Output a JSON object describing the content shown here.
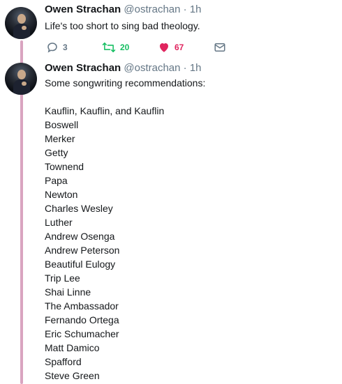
{
  "tweets": [
    {
      "author_name": "Owen Strachan",
      "handle": "@ostrachan",
      "separator": "·",
      "time": "1h",
      "text": "Life's too short to sing bad theology.",
      "actions": {
        "replies": "3",
        "retweets": "20",
        "likes": "67"
      }
    },
    {
      "author_name": "Owen Strachan",
      "handle": "@ostrachan",
      "separator": "·",
      "time": "1h",
      "intro": "Some songwriting recommendations:",
      "items": [
        "Kauflin, Kauflin, and Kauflin",
        "Boswell",
        "Merker",
        "Getty",
        "Townend",
        "Papa",
        "Newton",
        "Charles Wesley",
        "Luther",
        "Andrew Osenga",
        "Andrew Peterson",
        "Beautiful Eulogy",
        "Trip Lee",
        "Shai Linne",
        "The Ambassador",
        "Fernando Ortega",
        "Eric Schumacher",
        "Matt Damico",
        "Spafford",
        "Steve Green"
      ]
    }
  ],
  "colors": {
    "thread_line": "#d9a4c0",
    "retweet": "#17bf63",
    "like": "#e0245e",
    "muted": "#657786"
  },
  "icons": [
    "reply-icon",
    "retweet-icon",
    "heart-icon",
    "envelope-icon"
  ]
}
